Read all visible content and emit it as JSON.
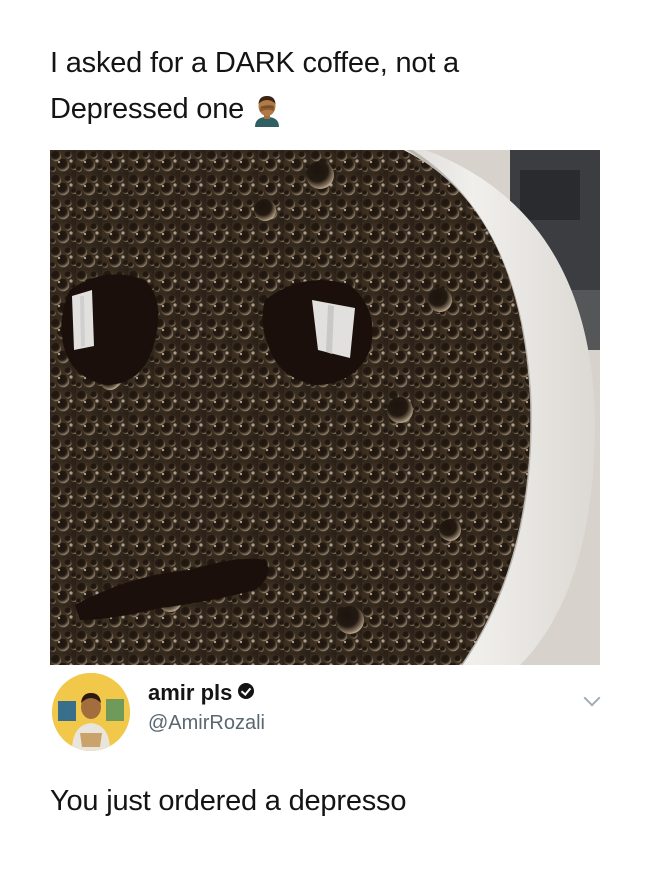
{
  "post": {
    "line1": "I asked for a DARK coffee, not a",
    "line2": "Depressed one",
    "emoji": "man-facepalming-emoji"
  },
  "photo": {
    "subject": "coffee-cup-photo"
  },
  "reply": {
    "display_name": "amir pls",
    "handle": "@AmirRozali",
    "text": "You just ordered a depresso",
    "icons": [
      "verified-badge-icon",
      "chevron-down-icon"
    ]
  },
  "colors": {
    "text": "#141414",
    "handle": "#5b6770",
    "coffee": "#3a2e22",
    "cup": "#e8e6e2",
    "avatar_bg": "#f2c84a"
  }
}
